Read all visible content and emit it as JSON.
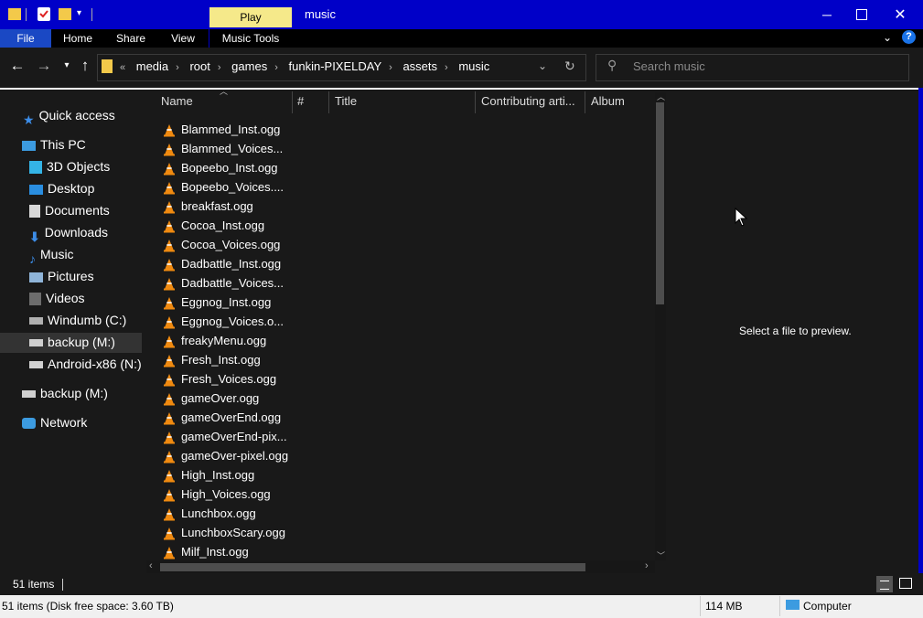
{
  "window": {
    "title": "music",
    "context_tab": "Play"
  },
  "ribbon": {
    "tabs": [
      "File",
      "Home",
      "Share",
      "View",
      "Music Tools"
    ]
  },
  "address": {
    "crumbs": [
      "media",
      "root",
      "games",
      "funkin-PIXELDAY",
      "assets",
      "music"
    ],
    "overflow": "«"
  },
  "search": {
    "placeholder": "Search music"
  },
  "nav": {
    "quick_access": "Quick access",
    "this_pc": "This PC",
    "items": [
      "3D Objects",
      "Desktop",
      "Documents",
      "Downloads",
      "Music",
      "Pictures",
      "Videos",
      "Windumb (C:)",
      "backup (M:)",
      "Android-x86 (N:)"
    ],
    "backup": "backup (M:)",
    "network": "Network"
  },
  "columns": [
    "Name",
    "#",
    "Title",
    "Contributing arti...",
    "Album"
  ],
  "files": [
    "Blammed_Inst.ogg",
    "Blammed_Voices...",
    "Bopeebo_Inst.ogg",
    "Bopeebo_Voices....",
    "breakfast.ogg",
    "Cocoa_Inst.ogg",
    "Cocoa_Voices.ogg",
    "Dadbattle_Inst.ogg",
    "Dadbattle_Voices...",
    "Eggnog_Inst.ogg",
    "Eggnog_Voices.o...",
    "freakyMenu.ogg",
    "Fresh_Inst.ogg",
    "Fresh_Voices.ogg",
    "gameOver.ogg",
    "gameOverEnd.ogg",
    "gameOverEnd-pix...",
    "gameOver-pixel.ogg",
    "High_Inst.ogg",
    "High_Voices.ogg",
    "Lunchbox.ogg",
    "LunchboxScary.ogg",
    "Milf_Inst.ogg"
  ],
  "preview": {
    "message": "Select a file to preview."
  },
  "status": {
    "count": "51 items",
    "detail": "51 items (Disk free space: 3.60 TB)",
    "size": "114 MB",
    "location": "Computer"
  }
}
